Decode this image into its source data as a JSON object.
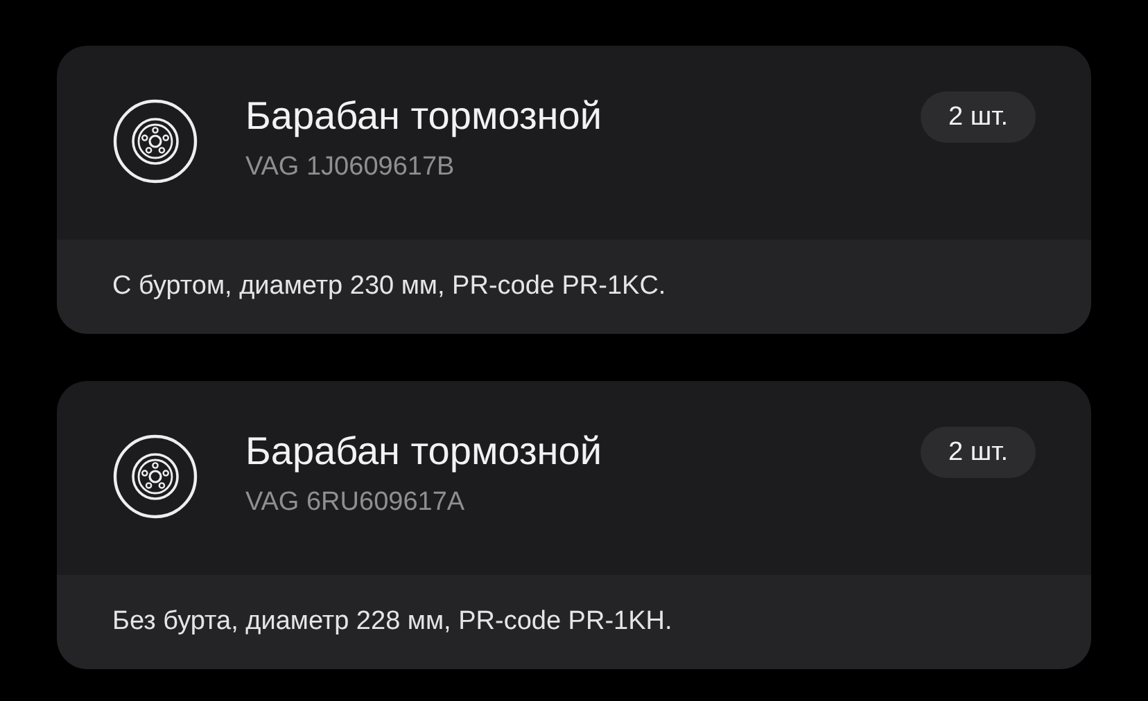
{
  "parts": [
    {
      "title": "Барабан тормозной",
      "code": "VAG 1J0609617B",
      "quantity": "2 шт.",
      "note": "С буртом, диаметр 230 мм, PR-code PR-1KC."
    },
    {
      "title": "Барабан тормозной",
      "code": "VAG 6RU609617A",
      "quantity": "2 шт.",
      "note": "Без бурта, диаметр 228 мм, PR-code PR-1KH."
    }
  ]
}
